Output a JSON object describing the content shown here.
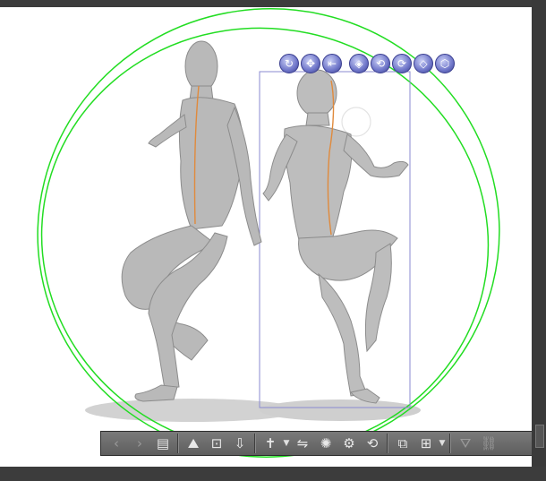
{
  "canvas": {
    "background": "#ffffff",
    "accent_selection_ring": "#22dd22",
    "bounding_box_color": "#8888cc"
  },
  "model_gizmos": [
    {
      "name": "rotate-camera-icon",
      "glyph": "↻"
    },
    {
      "name": "pan-camera-icon",
      "glyph": "✥"
    },
    {
      "name": "move-forward-icon",
      "glyph": "⇤"
    },
    {
      "name": "move-3d-icon",
      "glyph": "◈"
    },
    {
      "name": "rotate-3d-icon",
      "glyph": "⟲"
    },
    {
      "name": "rotate-plane-icon",
      "glyph": "⟳"
    },
    {
      "name": "scale-plane-icon",
      "glyph": "◇"
    },
    {
      "name": "scale-3d-icon",
      "glyph": "⬡"
    }
  ],
  "toolbar": {
    "buttons": [
      {
        "name": "previous-object-icon",
        "glyph": "‹",
        "dim": true
      },
      {
        "name": "next-object-icon",
        "glyph": "›",
        "dim": true
      },
      {
        "name": "object-list-icon",
        "glyph": "▤",
        "dim": false
      },
      {
        "name": "sep"
      },
      {
        "name": "camera-angle-icon",
        "glyph": "⛰",
        "dim": false
      },
      {
        "name": "fit-to-view-icon",
        "glyph": "⊡",
        "dim": false
      },
      {
        "name": "ground-plane-icon",
        "glyph": "⇩",
        "dim": false
      },
      {
        "name": "sep"
      },
      {
        "name": "pose-preset-icon",
        "glyph": "✝",
        "dim": false,
        "caret": true
      },
      {
        "name": "flip-pose-icon",
        "glyph": "⇋",
        "dim": false
      },
      {
        "name": "reset-pose-icon",
        "glyph": "✺",
        "dim": false
      },
      {
        "name": "joint-lock-icon",
        "glyph": "⚙",
        "dim": false
      },
      {
        "name": "rotate-body-icon",
        "glyph": "⟲",
        "dim": false
      },
      {
        "name": "sep"
      },
      {
        "name": "body-shape-icon",
        "glyph": "⧉",
        "dim": false
      },
      {
        "name": "object-settings-icon",
        "glyph": "⊞",
        "dim": false,
        "caret": true
      },
      {
        "name": "sep"
      },
      {
        "name": "landing-icon",
        "glyph": "⛛",
        "dim": true
      },
      {
        "name": "link-icon",
        "glyph": "⛓",
        "dim": true
      }
    ]
  }
}
